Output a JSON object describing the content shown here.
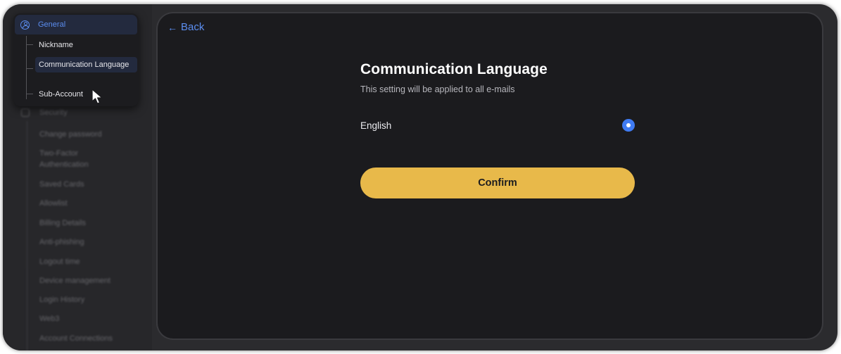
{
  "sidebar": {
    "general_label": "General",
    "general_items": [
      "Nickname",
      "Communication Language",
      "Sub-Account"
    ],
    "security_label": "Security",
    "security_items": [
      "Change password",
      "Two-Factor Authentication",
      "Saved Cards",
      "Allowlist",
      "Billing Details",
      "Anti-phishing",
      "Logout time",
      "Device management",
      "Login History",
      "Web3",
      "Account Connections"
    ]
  },
  "main": {
    "back_label": "Back",
    "title": "Communication Language",
    "subtitle": "This setting will be applied to all e-mails",
    "language_option": "English",
    "language_selected": true,
    "confirm_label": "Confirm"
  },
  "colors": {
    "accent": "#5b8def",
    "radio": "#3f7bf3",
    "confirm_button": "#e8b94a",
    "panel_bg": "#1b1b1e"
  }
}
